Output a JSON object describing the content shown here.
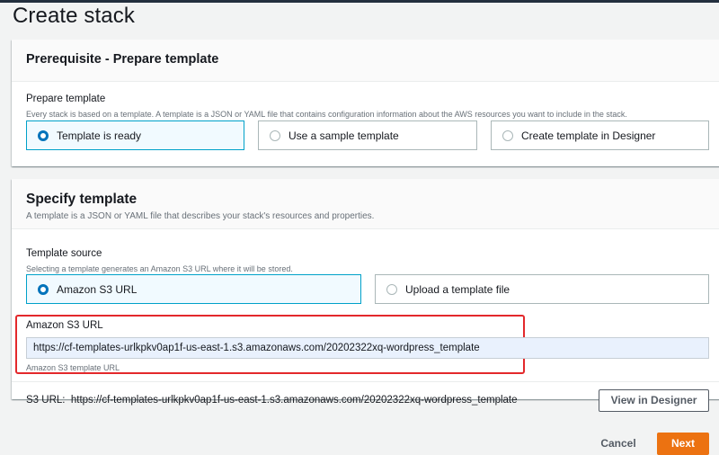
{
  "page": {
    "title": "Create stack"
  },
  "prerequisite": {
    "title": "Prerequisite - Prepare template",
    "field_label": "Prepare template",
    "field_description": "Every stack is based on a template. A template is a JSON or YAML file that contains configuration information about the AWS resources you want to include in the stack.",
    "options": [
      {
        "label": "Template is ready",
        "selected": true
      },
      {
        "label": "Use a sample template",
        "selected": false
      },
      {
        "label": "Create template in Designer",
        "selected": false
      }
    ]
  },
  "specify": {
    "title": "Specify template",
    "description": "A template is a JSON or YAML file that describes your stack's resources and properties.",
    "source_label": "Template source",
    "source_description": "Selecting a template generates an Amazon S3 URL where it will be stored.",
    "options": [
      {
        "label": "Amazon S3 URL",
        "selected": true
      },
      {
        "label": "Upload a template file",
        "selected": false
      }
    ],
    "s3_url_label": "Amazon S3 URL",
    "s3_url_value": "https://cf-templates-urlkpkv0ap1f-us-east-1.s3.amazonaws.com/20202322xq-wordpress_template",
    "s3_url_hint": "Amazon S3 template URL",
    "s3_url_summary_label": "S3 URL:",
    "s3_url_summary_value": "https://cf-templates-urlkpkv0ap1f-us-east-1.s3.amazonaws.com/20202322xq-wordpress_template",
    "view_in_designer_label": "View in Designer"
  },
  "footer": {
    "cancel_label": "Cancel",
    "next_label": "Next"
  },
  "colors": {
    "primary_button": "#ec7211",
    "selected_radio": "#0073bb",
    "selected_tile_border": "#00a1c9",
    "highlight_box": "#e3282b"
  }
}
